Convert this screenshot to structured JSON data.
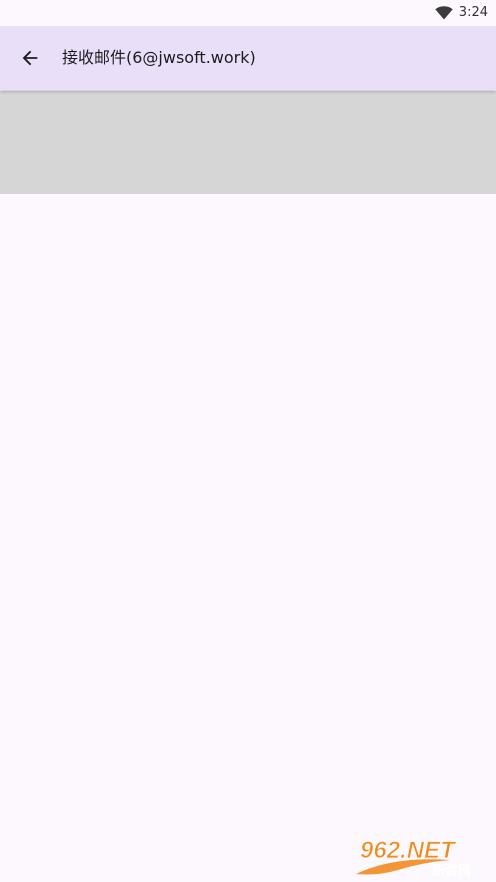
{
  "status_bar": {
    "time": "3:24",
    "wifi_icon": "wifi-icon"
  },
  "app_bar": {
    "back_icon": "arrow-back-icon",
    "title": "接收邮件(6@jwsoft.work)"
  },
  "watermark": {
    "brand": "962.NET",
    "subtitle": "乐游网"
  },
  "colors": {
    "app_bar_bg": "#eadff9",
    "banner_bg": "#d6d6d6",
    "page_bg": "#fdf7fe",
    "watermark_orange": "#f28a1f"
  }
}
